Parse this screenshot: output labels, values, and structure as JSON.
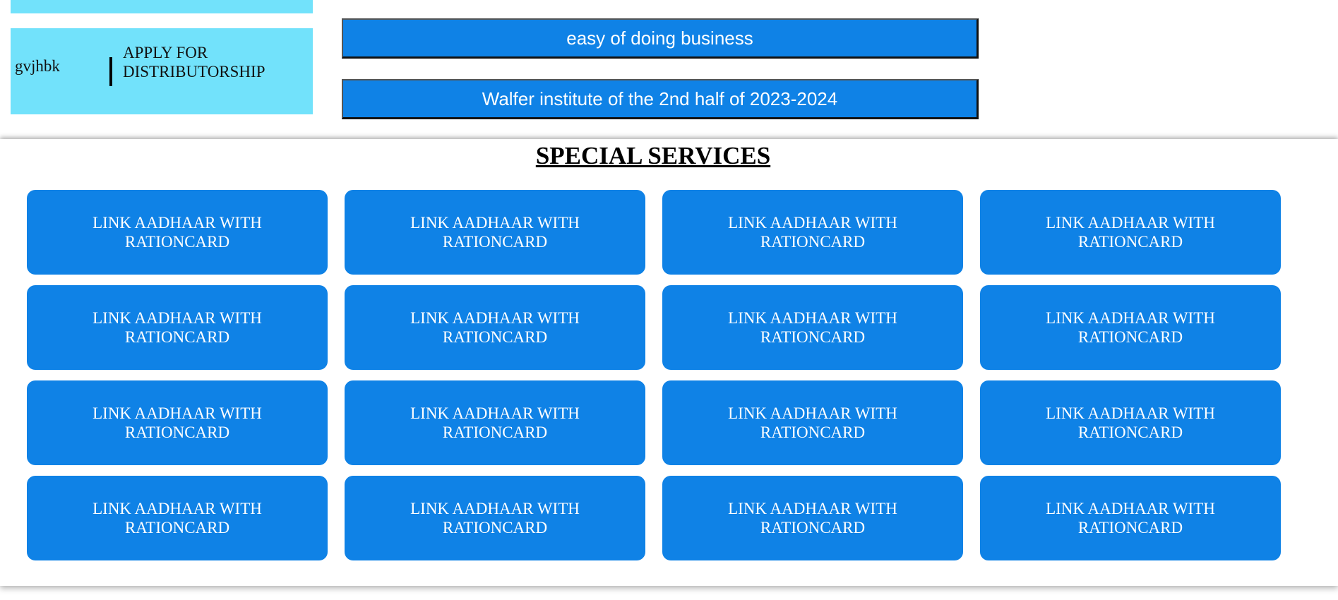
{
  "distributor_card": {
    "name": "gvjhbk",
    "apply_label": "APPLY FOR DISTRIBUTORSHIP"
  },
  "banners": [
    {
      "label": "easy of doing business"
    },
    {
      "label": "Walfer institute of the 2nd half of 2023-2024"
    }
  ],
  "services": {
    "title": "SPECIAL SERVICES",
    "items": [
      {
        "label": "LINK AADHAAR WITH RATIONCARD"
      },
      {
        "label": "LINK AADHAAR WITH RATIONCARD"
      },
      {
        "label": "LINK AADHAAR WITH RATIONCARD"
      },
      {
        "label": "LINK AADHAAR WITH RATIONCARD"
      },
      {
        "label": "LINK AADHAAR WITH RATIONCARD"
      },
      {
        "label": "LINK AADHAAR WITH RATIONCARD"
      },
      {
        "label": "LINK AADHAAR WITH RATIONCARD"
      },
      {
        "label": "LINK AADHAAR WITH RATIONCARD"
      },
      {
        "label": "LINK AADHAAR WITH RATIONCARD"
      },
      {
        "label": "LINK AADHAAR WITH RATIONCARD"
      },
      {
        "label": "LINK AADHAAR WITH RATIONCARD"
      },
      {
        "label": "LINK AADHAAR WITH RATIONCARD"
      },
      {
        "label": "LINK AADHAAR WITH RATIONCARD"
      },
      {
        "label": "LINK AADHAAR WITH RATIONCARD"
      },
      {
        "label": "LINK AADHAAR WITH RATIONCARD"
      },
      {
        "label": "LINK AADHAAR WITH RATIONCARD"
      }
    ]
  },
  "colors": {
    "cyan": "#72e2fb",
    "button_blue": "#0f82e6"
  }
}
